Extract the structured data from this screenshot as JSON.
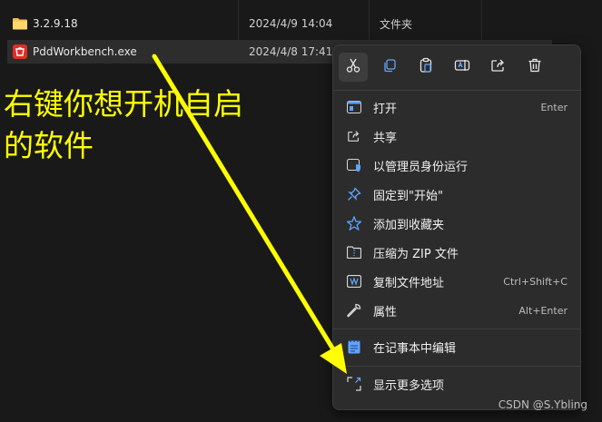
{
  "files": [
    {
      "name": "3.2.9.18",
      "date": "2024/4/9 14:04",
      "type": "文件夹",
      "icon": "folder-icon"
    },
    {
      "name": "PddWorkbench.exe",
      "date": "2024/4/8 17:41",
      "type": "",
      "icon": "app-icon"
    }
  ],
  "annotation": {
    "line1": "右键你想开机自启",
    "line2": "的软件"
  },
  "toolbar": [
    "cut-icon",
    "copy-icon",
    "paste-icon",
    "rename-icon",
    "share-icon",
    "delete-icon"
  ],
  "menu_items": [
    {
      "label": "打开",
      "shortcut": "Enter",
      "icon": "open-icon"
    },
    {
      "label": "共享",
      "shortcut": "",
      "icon": "share-icon"
    },
    {
      "label": "以管理员身份运行",
      "shortcut": "",
      "icon": "shield-icon"
    },
    {
      "label": "固定到\"开始\"",
      "shortcut": "",
      "icon": "pin-icon"
    },
    {
      "label": "添加到收藏夹",
      "shortcut": "",
      "icon": "star-icon"
    },
    {
      "label": "压缩为 ZIP 文件",
      "shortcut": "",
      "icon": "zip-icon"
    },
    {
      "label": "复制文件地址",
      "shortcut": "Ctrl+Shift+C",
      "icon": "path-icon"
    },
    {
      "label": "属性",
      "shortcut": "Alt+Enter",
      "icon": "wrench-icon"
    },
    {
      "label": "在记事本中编辑",
      "shortcut": "",
      "icon": "notepad-icon"
    },
    {
      "label": "显示更多选项",
      "shortcut": "",
      "icon": "more-options-icon"
    }
  ],
  "watermark": "CSDN @S.Ybling",
  "colors": {
    "accent": "#ffff00",
    "menu_bg": "#2c2c2c",
    "icon_blue": "#60a5fa"
  }
}
